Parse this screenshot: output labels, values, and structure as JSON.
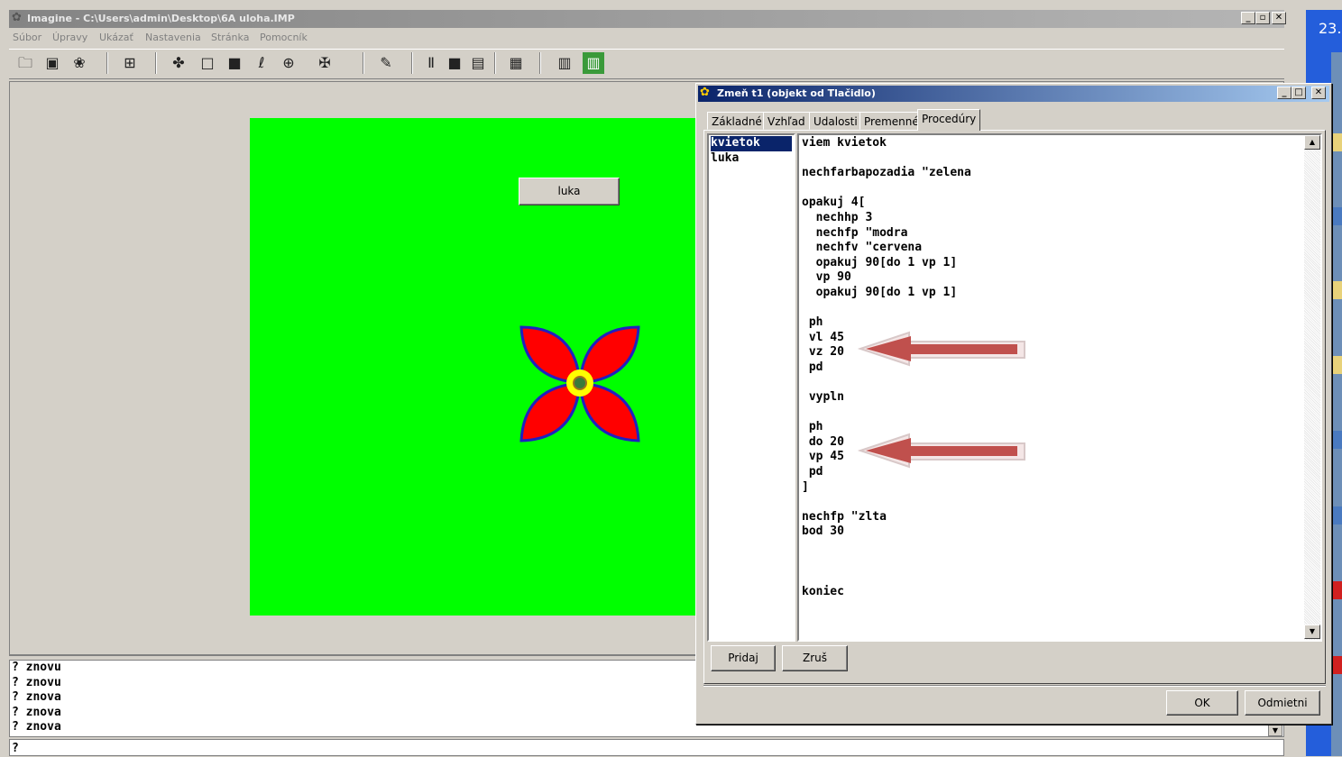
{
  "window": {
    "title": "Imagine - C:\\Users\\admin\\Desktop\\6A uloha.IMP",
    "controls": [
      "_",
      "🗗",
      "✕"
    ]
  },
  "menu": [
    "Súbor",
    "Úpravy",
    "Ukázať",
    "Nastavenia",
    "Stránka",
    "Pomocník"
  ],
  "toolbar": {
    "icons": [
      "open-icon",
      "save-icon",
      "print-icon",
      "tree-icon",
      "turtle-icon",
      "frame-icon",
      "rect-icon",
      "shape-icon",
      "target-icon",
      "tool-icon",
      "paint-icon",
      "pause-icon",
      "stop-icon",
      "run-icon",
      "window-icon",
      "panel-icon",
      "panel-green-icon"
    ]
  },
  "canvas": {
    "background_color": "#00ff00",
    "button_label": "luka"
  },
  "console": {
    "lines": [
      "? znovu",
      "? znovu",
      "? znova",
      "? znova",
      "? znova"
    ],
    "prompt": "?"
  },
  "dialog": {
    "title": "Zmeň t1 (objekt od Tlačidlo)",
    "tabs": [
      "Základné",
      "Vzhľad",
      "Udalosti",
      "Premenné",
      "Procedúry"
    ],
    "active_tab": "Procedúry",
    "procedures": [
      "kvietok",
      "luka"
    ],
    "selected_procedure": "kvietok",
    "code": [
      "viem kvietok",
      "",
      "nechfarbapozadia \"zelena",
      "",
      "opakuj 4[",
      "  nechhp 3",
      "  nechfp \"modra",
      "  nechfv \"cervena",
      "  opakuj 90[do 1 vp 1]",
      "  vp 90",
      "  opakuj 90[do 1 vp 1]",
      "",
      " ph",
      " vl 45",
      " vz 20",
      " pd",
      "",
      " vypln",
      "",
      " ph",
      " do 20",
      " vp 45",
      " pd",
      "]",
      "",
      "nechfp \"zlta",
      "bod 30",
      "",
      "",
      "",
      "koniec"
    ],
    "add_button": "Pridaj",
    "remove_button": "Zruš",
    "ok_button": "OK",
    "cancel_button": "Odmietni"
  },
  "taskbar": {
    "clock": "23."
  }
}
